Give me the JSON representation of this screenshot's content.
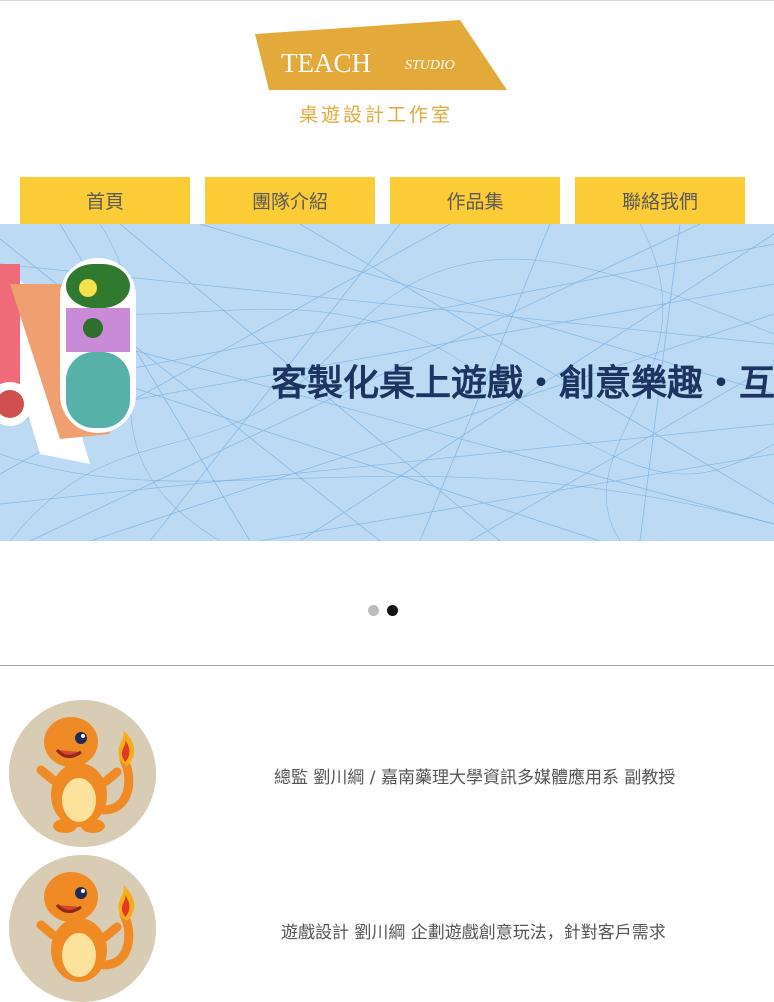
{
  "logo": {
    "main": "TEACH",
    "sub": "STUDIO",
    "tagline": "桌遊設計工作室",
    "color": "#e4a93b"
  },
  "nav": {
    "items": [
      {
        "label": "首頁"
      },
      {
        "label": "團隊介紹"
      },
      {
        "label": "作品集"
      },
      {
        "label": "聯絡我們"
      }
    ],
    "color": "#fccc37"
  },
  "banner": {
    "text": "客製化桌上遊戲・創意樂趣・互"
  },
  "carousel": {
    "slide_count": 2,
    "active_index": 1
  },
  "team": {
    "members": [
      {
        "text": "總監 劉川綱 / 嘉南藥理大學資訊多媒體應用系 副教授"
      },
      {
        "text": "遊戲設計 劉川綱 企劃遊戲創意玩法，針對客戶需求"
      }
    ]
  }
}
